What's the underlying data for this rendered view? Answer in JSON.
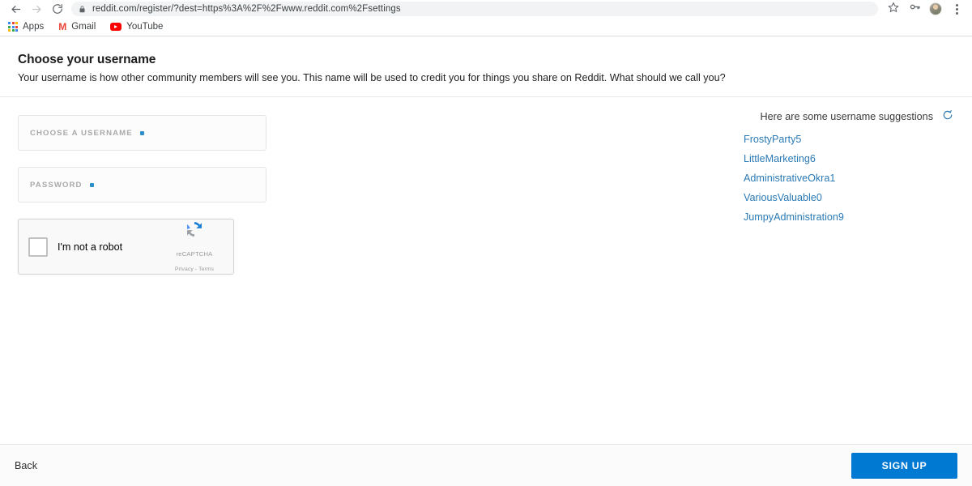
{
  "browser": {
    "nav": {
      "back_icon": "arrow-left-icon",
      "forward_icon": "arrow-right-icon",
      "reload_icon": "reload-icon"
    },
    "omnibox": {
      "lock_icon": "lock-icon",
      "url": "reddit.com/register/?dest=https%3A%2F%2Fwww.reddit.com%2Fsettings",
      "url_domain": "reddit.com",
      "url_path": "/register/?dest=https%3A%2F%2Fwww.reddit.com%2Fsettings"
    },
    "toolbar_icons": {
      "bookmark_star": "star-icon",
      "password_key": "key-icon",
      "profile_avatar": "avatar",
      "menu": "three-dots-icon"
    },
    "bookmarks": [
      {
        "label": "Apps",
        "icon": "apps-grid-icon"
      },
      {
        "label": "Gmail",
        "icon": "gmail-icon"
      },
      {
        "label": "YouTube",
        "icon": "youtube-icon"
      }
    ]
  },
  "header": {
    "title": "Choose your username",
    "subtitle": "Your username is how other community members will see you. This name will be used to credit you for things you share on Reddit. What should we call you?"
  },
  "form": {
    "username_field": {
      "label": "CHOOSE A USERNAME",
      "value": "",
      "required": true
    },
    "password_field": {
      "label": "PASSWORD",
      "value": "",
      "required": true
    }
  },
  "recaptcha": {
    "label": "I'm not a robot",
    "brand": "reCAPTCHA",
    "legal": "Privacy - Terms",
    "checked": false,
    "logo_icon": "recaptcha-icon"
  },
  "suggestions": {
    "heading": "Here are some username suggestions",
    "refresh_icon": "refresh-icon",
    "items": [
      "FrostyParty5",
      "LittleMarketing6",
      "AdministrativeOkra1",
      "VariousValuable0",
      "JumpyAdministration9"
    ]
  },
  "footer": {
    "back_label": "Back",
    "signup_label": "SIGN UP"
  },
  "colors": {
    "accent_blue": "#0079d3",
    "link_blue": "#2a7ab5",
    "required_dot": "#2d8ecb"
  }
}
